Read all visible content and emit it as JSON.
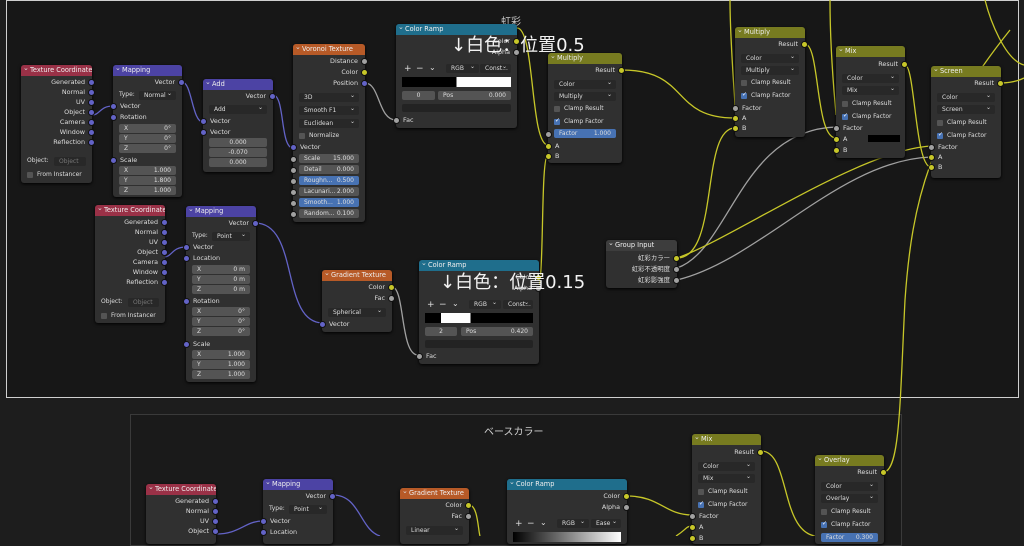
{
  "frames": {
    "top_title": "虹彩",
    "bottom_title": "ベースカラー"
  },
  "annotations": {
    "a1": "↓白色：位置0.5",
    "a2": "↓白色：位置0.15"
  },
  "colors": {
    "input": "#9a3147",
    "vector": "#4c43a4",
    "texture": "#b75a27",
    "converter": "#1f6e8c",
    "color": "#777b20",
    "wire_yellow": "#c7c729",
    "wire_gray": "#a1a1a1",
    "wire_purple": "#6363c7"
  },
  "tc1": {
    "title": "Texture Coordinate",
    "outputs": [
      "Generated",
      "Normal",
      "UV",
      "Object",
      "Camera",
      "Window",
      "Reflection"
    ],
    "object_label": "Object:",
    "object_placeholder": "Object",
    "from_instancer": "From Instancer"
  },
  "map1": {
    "title": "Mapping",
    "out": "Vector",
    "type_label": "Type:",
    "type_value": "Normal",
    "vector": "Vector",
    "rotation": "Rotation",
    "scale": "Scale",
    "rot": [
      [
        "X",
        "0°"
      ],
      [
        "Y",
        "0°"
      ],
      [
        "Z",
        "0°"
      ]
    ],
    "sc": [
      [
        "X",
        "1.000"
      ],
      [
        "Y",
        "1.800"
      ],
      [
        "Z",
        "1.000"
      ]
    ]
  },
  "add1": {
    "title": "Add",
    "out": "Vector",
    "op": "Add",
    "in1": "Vector",
    "in2": "Vector",
    "vals": [
      "0.000",
      "-0.070",
      "0.000"
    ]
  },
  "voronoi": {
    "title": "Voronoi Texture",
    "outputs": [
      "Distance",
      "Color",
      "Position"
    ],
    "dim": "3D",
    "feature": "Smooth F1",
    "metric": "Euclidean",
    "normalize": "Normalize",
    "vector": "Vector",
    "fields": [
      [
        "Scale",
        "15.000"
      ],
      [
        "Detail",
        "0.000"
      ],
      [
        "Roughn...",
        "0.500"
      ],
      [
        "Lacunari...",
        "2.000"
      ],
      [
        "Smooth...",
        "1.000"
      ],
      [
        "Random...",
        "0.100"
      ]
    ]
  },
  "ramp1": {
    "title": "Color Ramp",
    "color": "Color",
    "alpha": "Alpha",
    "plus": "+",
    "minus": "−",
    "mode": "RGB",
    "interp": "Const...",
    "index": "0",
    "pos_label": "Pos",
    "pos": "0.000",
    "fac": "Fac"
  },
  "mult1": {
    "title": "Multiply",
    "result": "Result",
    "type": "Color",
    "blend": "Multiply",
    "clamp_result": "Clamp Result",
    "clamp_factor": "Clamp Factor",
    "factor_label": "Factor",
    "factor": "1.000",
    "a": "A",
    "b": "B"
  },
  "mult2": {
    "title": "Multiply",
    "result": "Result",
    "type": "Color",
    "blend": "Multiply",
    "clamp_result": "Clamp Result",
    "clamp_factor": "Clamp Factor",
    "factor": "Factor",
    "a": "A",
    "b": "B"
  },
  "mix1": {
    "title": "Mix",
    "result": "Result",
    "type": "Color",
    "blend": "Mix",
    "clamp_result": "Clamp Result",
    "clamp_factor": "Clamp Factor",
    "factor": "Factor",
    "a": "A",
    "b": "B"
  },
  "screen": {
    "title": "Screen",
    "result": "Result",
    "type": "Color",
    "blend": "Screen",
    "clamp_result": "Clamp Result",
    "clamp_factor": "Clamp Factor",
    "factor": "Factor",
    "a": "A",
    "b": "B"
  },
  "tc2": {
    "title": "Texture Coordinate",
    "outputs": [
      "Generated",
      "Normal",
      "UV",
      "Object",
      "Camera",
      "Window",
      "Reflection"
    ],
    "object_label": "Object:",
    "object_placeholder": "Object",
    "from_instancer": "From Instancer"
  },
  "map2": {
    "title": "Mapping",
    "out": "Vector",
    "type_label": "Type:",
    "type_value": "Point",
    "vector": "Vector",
    "location": "Location",
    "rotation": "Rotation",
    "scale": "Scale",
    "loc": [
      [
        "X",
        "0 m"
      ],
      [
        "Y",
        "0 m"
      ],
      [
        "Z",
        "0 m"
      ]
    ],
    "rot": [
      [
        "X",
        "0°"
      ],
      [
        "Y",
        "0°"
      ],
      [
        "Z",
        "0°"
      ]
    ],
    "sc": [
      [
        "X",
        "1.000"
      ],
      [
        "Y",
        "1.000"
      ],
      [
        "Z",
        "1.000"
      ]
    ]
  },
  "grad1": {
    "title": "Gradient Texture",
    "color": "Color",
    "fac": "Fac",
    "type": "Spherical",
    "vector": "Vector"
  },
  "ramp2": {
    "title": "Color Ramp",
    "color": "Color",
    "alpha": "Alpha",
    "plus": "+",
    "minus": "−",
    "mode": "RGB",
    "interp": "Const...",
    "index": "2",
    "pos_label": "Pos",
    "pos": "0.420",
    "fac": "Fac"
  },
  "group": {
    "title": "Group Input",
    "outputs": [
      "虹彩カラー",
      "虹彩不透明度",
      "虹彩影強度"
    ]
  },
  "tc3": {
    "title": "Texture Coordinate",
    "outputs": [
      "Generated",
      "Normal",
      "UV",
      "Object"
    ]
  },
  "map3": {
    "title": "Mapping",
    "out": "Vector",
    "type_label": "Type:",
    "type_value": "Point",
    "vector": "Vector",
    "location": "Location"
  },
  "grad2": {
    "title": "Gradient Texture",
    "color": "Color",
    "fac": "Fac",
    "type": "Linear"
  },
  "ramp3": {
    "title": "Color Ramp",
    "color": "Color",
    "alpha": "Alpha",
    "plus": "+",
    "minus": "−",
    "mode": "RGB",
    "interp": "Ease"
  },
  "mix2": {
    "title": "Mix",
    "result": "Result",
    "type": "Color",
    "blend": "Mix",
    "clamp_result": "Clamp Result",
    "clamp_factor": "Clamp Factor",
    "factor": "Factor",
    "a": "A",
    "b": "B"
  },
  "overlay": {
    "title": "Overlay",
    "result": "Result",
    "type": "Color",
    "blend": "Overlay",
    "clamp_result": "Clamp Result",
    "clamp_factor": "Clamp Factor",
    "factor_label": "Factor",
    "factor": "0.300"
  }
}
